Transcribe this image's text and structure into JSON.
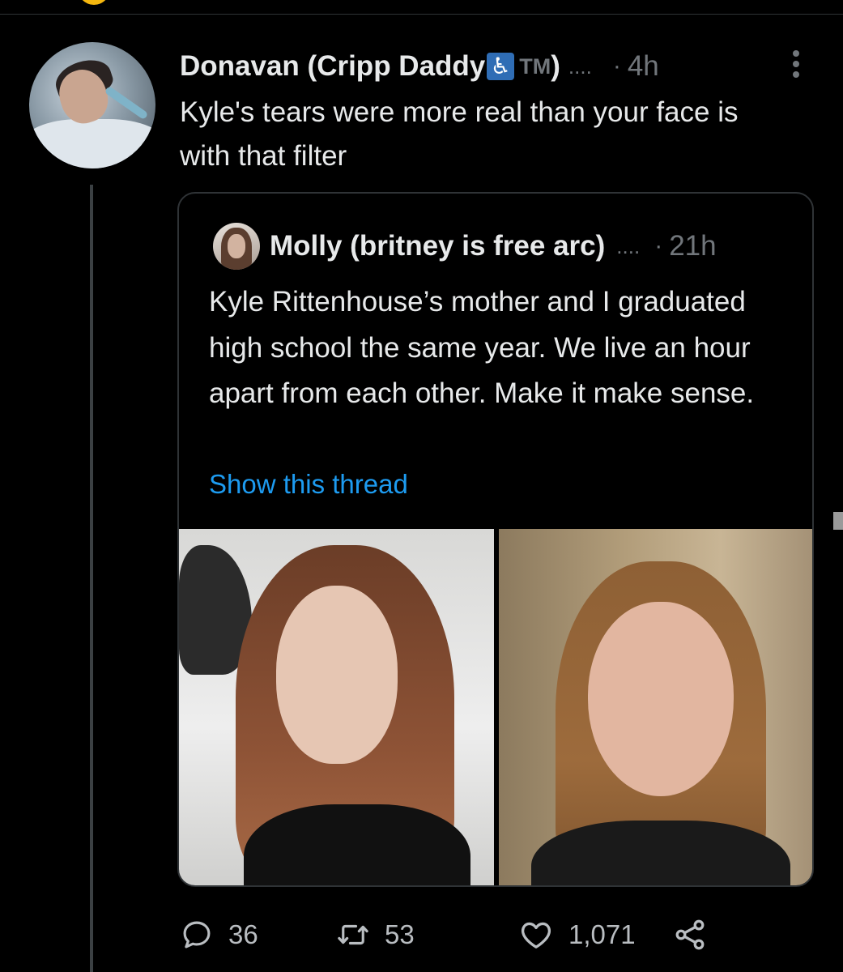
{
  "reply": {
    "display_name": "Donavan (Cripp Daddy",
    "badge_glyph": "♿",
    "tm": "TM",
    "name_close": ")",
    "ellipsis": "....",
    "dot": "·",
    "time": "4h",
    "text": "Kyle's tears were more real than your face is with that filter"
  },
  "quote": {
    "display_name": "Molly (britney is free arc)",
    "ellipsis": "....",
    "dot": "·",
    "time": "21h",
    "text": "Kyle Rittenhouse’s mother and I graduated high school the same year. We live an hour apart from each other. Make it make sense.",
    "show_thread": "Show this thread"
  },
  "actions": {
    "replies": "36",
    "retweets": "53",
    "likes": "1,071"
  },
  "colors": {
    "background": "#000000",
    "text": "#e7e9ea",
    "muted": "#71767b",
    "link": "#1d9bf0",
    "border": "#2f3336"
  }
}
